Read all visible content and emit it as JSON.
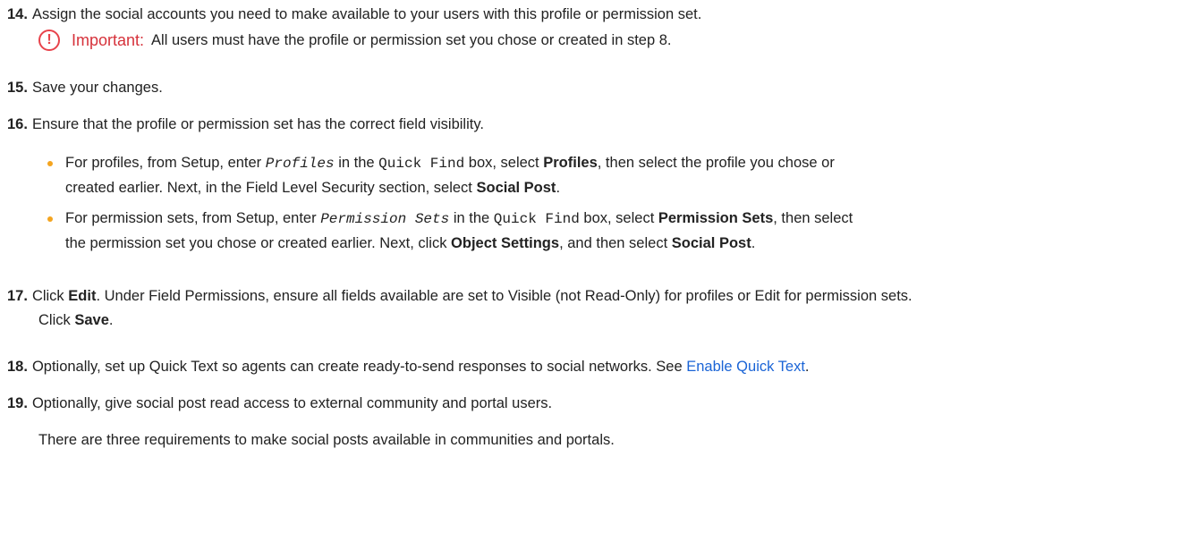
{
  "step14": {
    "num": "14.",
    "text": "Assign the social accounts you need to make available to your users with this profile or permission set."
  },
  "important": {
    "label": "Important:",
    "text": "All users must have the profile or permission set you chose or created in step 8.",
    "icon": "important-exclamation-icon",
    "color": "#e8434b"
  },
  "step15": {
    "num": "15.",
    "text": "Save your changes."
  },
  "step16": {
    "num": "16.",
    "text": "Ensure that the profile or permission set has the correct field visibility.",
    "bullet1": {
      "t1": "For profiles, from Setup, enter",
      "code1": "Profiles",
      "t2": "in the",
      "code2": "Quick Find",
      "t3": "box, select",
      "bold1": "Profiles",
      "t4": ", then select the profile you chose or",
      "t5": "created earlier. Next, in the Field Level Security section, select",
      "bold2": "Social Post",
      "t6": "."
    },
    "bullet2": {
      "t1": "For permission sets, from Setup, enter",
      "code1": "Permission Sets",
      "t2": "in the",
      "code2": "Quick Find",
      "t3": "box, select",
      "bold1": "Permission Sets",
      "t4": ", then select",
      "t5": "the permission set you chose or created earlier. Next, click",
      "bold2": "Object Settings",
      "t6": ", and then select",
      "bold3": "Social Post",
      "t7": "."
    },
    "bullet_color": "#f4a41f"
  },
  "step17": {
    "num": "17.",
    "t1": "Click",
    "bold1": "Edit",
    "t2": ". Under Field Permissions, ensure all fields available are set to Visible (not Read-Only) for profiles or Edit for permission sets.",
    "t3": "Click",
    "bold2": "Save",
    "t4": "."
  },
  "step18": {
    "num": "18.",
    "text": "Optionally, set up Quick Text so agents can create ready-to-send responses to social networks. See",
    "link": "Enable Quick Text",
    "end": "."
  },
  "step19": {
    "num": "19.",
    "text": "Optionally, give social post read access to external community and portal users.",
    "subtext": "There are three requirements to make social posts available in communities and portals."
  },
  "link_color": "#1a64d6"
}
